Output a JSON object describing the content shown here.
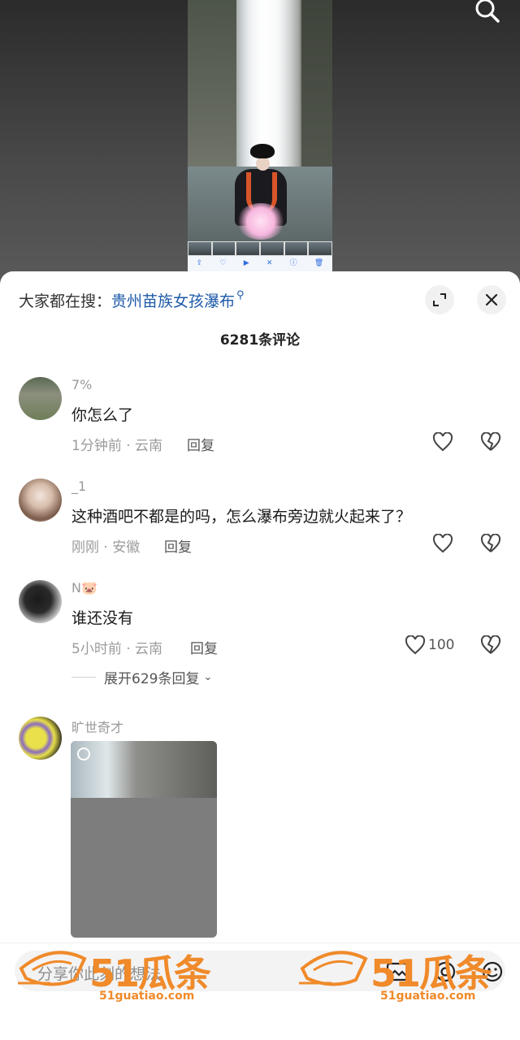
{
  "video": {
    "player_controls": [
      "share",
      "like",
      "play",
      "mute",
      "info",
      "delete"
    ]
  },
  "sheet": {
    "search_hint_prefix": "大家都在搜：",
    "search_hint_link": "贵州苗族女孩瀑布",
    "comment_count": "6281条评论"
  },
  "comments": [
    {
      "user": "7%",
      "text": "你怎么了",
      "meta": "1分钟前 · 云南",
      "reply": "回复"
    },
    {
      "user": "_1",
      "text": "这种酒吧不都是的吗，怎么瀑布旁边就火起来了？",
      "meta": "刚刚 · 安徽",
      "reply": "回复"
    },
    {
      "user": "N🐷",
      "text": "谁还没有",
      "meta": "5小时前 · 云南",
      "reply": "回复",
      "likes": "100",
      "expand": "展开629条回复"
    },
    {
      "user": "旷世奇才"
    }
  ],
  "input_bar": {
    "placeholder": "分享你此刻的想法"
  },
  "watermark": {
    "brand": "51瓜条",
    "url": "51guatiao.com"
  },
  "colors": {
    "link": "#1d5aa8",
    "watermark": "#f08a2a"
  }
}
